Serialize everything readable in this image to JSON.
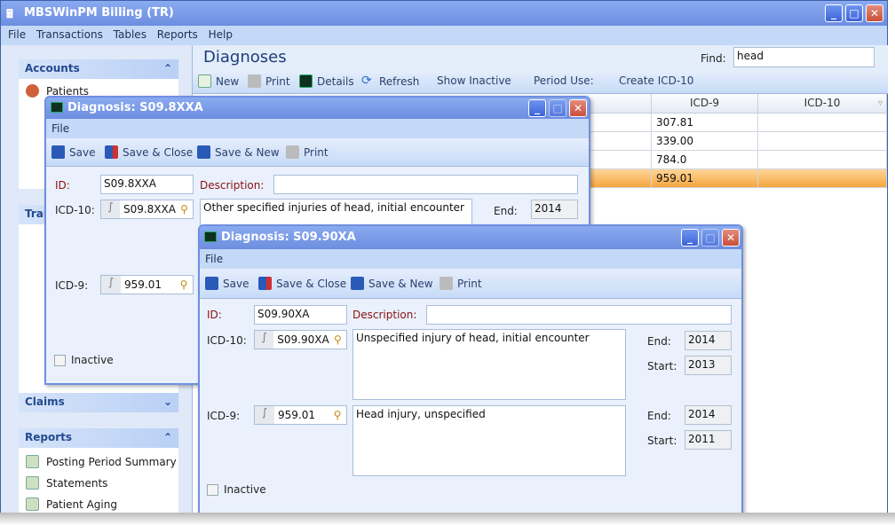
{
  "app": {
    "title": "MBSWinPM Billing (TR)",
    "menu": [
      "File",
      "Transactions",
      "Tables",
      "Reports",
      "Help"
    ]
  },
  "sidebar": {
    "accounts": {
      "header": "Accounts",
      "items": [
        "Patients"
      ]
    },
    "transactions": {
      "header": "Transactions"
    },
    "claims": {
      "header": "Claims"
    },
    "reports": {
      "header": "Reports",
      "items": [
        "Posting Period Summary",
        "Statements",
        "Patient Aging"
      ]
    }
  },
  "main": {
    "title": "Diagnoses",
    "find_label": "Find:",
    "find_value": "head",
    "toolbar": {
      "new": "New",
      "print": "Print",
      "details": "Details",
      "refresh": "Refresh",
      "show_inactive": "Show Inactive",
      "period_use": "Period Use:",
      "create_icd10": "Create ICD-10"
    },
    "grid": {
      "columns": [
        "ICD-9",
        "ICD-10"
      ],
      "rows": [
        {
          "icd9": "307.81",
          "icd10": ""
        },
        {
          "icd9": "339.00",
          "icd10": ""
        },
        {
          "icd9": "784.0",
          "icd10": ""
        },
        {
          "icd9": "959.01",
          "icd10": "",
          "selected": true
        }
      ]
    }
  },
  "dialog1": {
    "title": "Diagnosis: S09.8XXA",
    "menu": "File",
    "toolbar": {
      "save": "Save",
      "save_close": "Save & Close",
      "save_new": "Save & New",
      "print": "Print"
    },
    "id_label": "ID:",
    "id": "S09.8XXA",
    "desc_label": "Description:",
    "description": "",
    "icd10_label": "ICD-10:",
    "icd10": "S09.8XXA",
    "icd10_desc": "Other specified injuries of head, initial encounter",
    "end_label": "End:",
    "icd10_end": "2014",
    "icd9_label": "ICD-9:",
    "icd9": "959.01",
    "inactive_label": "Inactive",
    "inactive": false
  },
  "dialog2": {
    "title": "Diagnosis: S09.90XA",
    "menu": "File",
    "toolbar": {
      "save": "Save",
      "save_close": "Save & Close",
      "save_new": "Save & New",
      "print": "Print"
    },
    "id_label": "ID:",
    "id": "S09.90XA",
    "desc_label": "Description:",
    "description": "",
    "icd10_label": "ICD-10:",
    "icd10": "S09.90XA",
    "icd10_desc": "Unspecified injury of head, initial encounter",
    "end_label": "End:",
    "start_label": "Start:",
    "icd10_end": "2014",
    "icd10_start": "2013",
    "icd9_label": "ICD-9:",
    "icd9": "959.01",
    "icd9_desc": "Head injury, unspecified",
    "icd9_end": "2014",
    "icd9_start": "2011",
    "inactive_label": "Inactive",
    "inactive": false
  },
  "colors": {
    "accent": "#6d8de0",
    "selected_row": "#f5a63d",
    "label_red": "#8a1010"
  }
}
